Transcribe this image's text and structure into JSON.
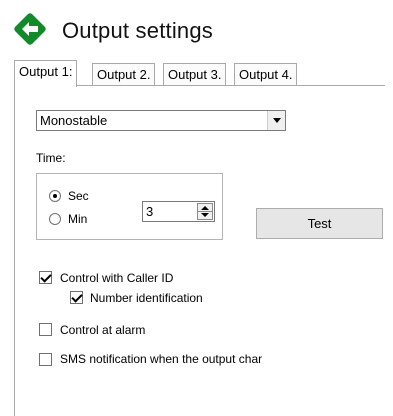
{
  "header": {
    "title": "Output settings",
    "logo_icon": "green-diamond-back-arrow-icon",
    "logo_color": "#138a2a"
  },
  "tabs": [
    {
      "label": "Output 1:",
      "active": true
    },
    {
      "label": "Output 2.",
      "active": false
    },
    {
      "label": "Output 3.",
      "active": false
    },
    {
      "label": "Output 4.",
      "active": false
    }
  ],
  "mode_select": {
    "value": "Monostable"
  },
  "time": {
    "label": "Time:",
    "options": [
      {
        "label": "Sec",
        "selected": true
      },
      {
        "label": "Min",
        "selected": false
      }
    ],
    "value": "3"
  },
  "test_button": {
    "label": "Test"
  },
  "checkboxes": [
    {
      "label": "Control with Caller ID",
      "checked": true
    },
    {
      "label": "Number identification",
      "checked": true
    },
    {
      "label": "Control at alarm",
      "checked": false
    },
    {
      "label": "SMS notification when the output char",
      "checked": false
    }
  ]
}
